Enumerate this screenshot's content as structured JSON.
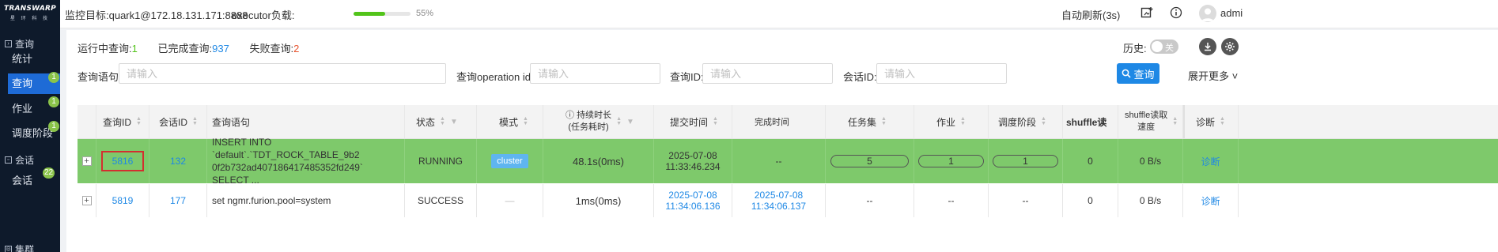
{
  "brand": {
    "name": "TRANSWARP",
    "sub": "星 环 科 技"
  },
  "sidebar": {
    "groups": [
      {
        "label": "查询",
        "items": [
          {
            "label": "统计",
            "badge": ""
          },
          {
            "label": "查询",
            "badge": "1"
          },
          {
            "label": "作业",
            "badge": "1"
          },
          {
            "label": "调度阶段",
            "badge": "1"
          }
        ]
      },
      {
        "label": "会话",
        "items": [
          {
            "label": "会话",
            "badge": "22"
          }
        ]
      },
      {
        "label": "集群"
      }
    ]
  },
  "topbar": {
    "target": "监控目标:quark1@172.18.131.171:8888",
    "executor_label": "executor负载:",
    "executor_load_pct": 55,
    "executor_load_text": "55%",
    "auto_refresh": "自动刷新(3s)",
    "user": "admi"
  },
  "stats": {
    "running_label": "运行中查询:",
    "running": "1",
    "done_label": "已完成查询:",
    "done": "937",
    "failed_label": "失败查询:",
    "failed": "2"
  },
  "history": {
    "label": "历史:",
    "toggle": "关"
  },
  "filters": {
    "stmt_label": "查询语句:",
    "opid_label": "查询operation id:",
    "qid_label": "查询ID:",
    "sid_label": "会话ID:",
    "placeholder": "请输入",
    "search": "查询",
    "more": "展开更多"
  },
  "table": {
    "headers": [
      "查询ID",
      "会话ID",
      "查询语句",
      "状态",
      "模式",
      "持续时长",
      "(任务耗时)",
      "提交时间",
      "完成时间",
      "任务集",
      "作业",
      "调度阶段",
      "shuffle读",
      "shuffle读取",
      "速度",
      "诊断"
    ],
    "rows": [
      {
        "query_id": "5816",
        "session_id": "132",
        "statement_l1": "INSERT INTO `default`.`TDT_ROCK_TABLE_9b2",
        "statement_l2": "0f2b732ad407186417485352fd249` SELECT ...",
        "status": "RUNNING",
        "mode": "cluster",
        "duration": "48.1s(0ms)",
        "submit_date": "2025-07-08",
        "submit_time": "11:33:46.234",
        "finish": "--",
        "taskset": "5",
        "job": "1",
        "stage": "1",
        "shuffle_read": "0",
        "shuffle_speed": "0 B/s",
        "diagnose": "诊断"
      },
      {
        "query_id": "5819",
        "session_id": "177",
        "statement_l1": "set ngmr.furion.pool=system",
        "status": "SUCCESS",
        "mode": "—",
        "duration": "1ms(0ms)",
        "submit_date": "2025-07-08",
        "submit_time": "11:34:06.136",
        "finish_date": "2025-07-08",
        "finish_time": "11:34:06.137",
        "taskset": "--",
        "job": "--",
        "stage": "--",
        "shuffle_read": "0",
        "shuffle_speed": "0 B/s",
        "diagnose": "诊断"
      }
    ]
  },
  "colors": {
    "sidebar": "#0e1a2b",
    "accent": "#1e88e5",
    "running_row": "#7ec96b",
    "failed": "#e8542f",
    "running": "#52c41a"
  }
}
